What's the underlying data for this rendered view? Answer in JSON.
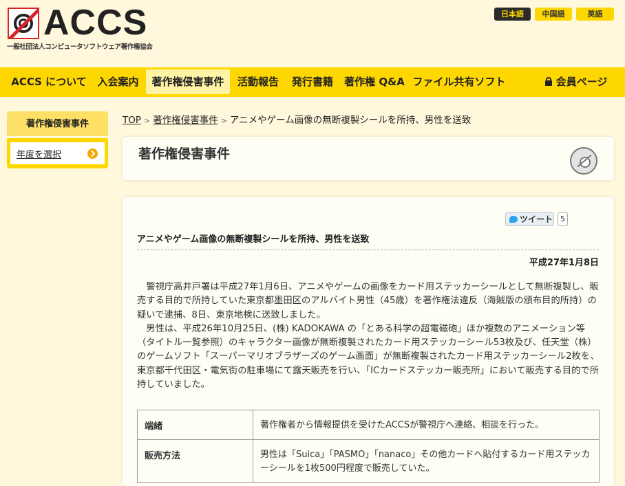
{
  "header": {
    "logo_text": "ACCS",
    "logo_sub": "一般社団法人コンピュータソフトウェア著作権協会",
    "languages": [
      {
        "label": "日本語",
        "active": true
      },
      {
        "label": "中国語",
        "active": false
      },
      {
        "label": "英語",
        "active": false
      }
    ]
  },
  "nav": {
    "items": [
      {
        "label": "ACCS について"
      },
      {
        "label": "入会案内"
      },
      {
        "label": "著作権侵害事件",
        "current": true
      },
      {
        "label": "活動報告"
      },
      {
        "label": "発行書籍"
      },
      {
        "label": "著作権 Q&A"
      },
      {
        "label": "ファイル共有ソフト"
      }
    ],
    "member_label": "会員ページ"
  },
  "sidebar": {
    "title": "著作権侵害事件",
    "select_label": "年度を選択"
  },
  "breadcrumb": {
    "top": "TOP",
    "category": "著作権侵害事件",
    "current": "アニメやゲーム画像の無断複製シールを所持、男性を送致"
  },
  "section": {
    "title": "著作権侵害事件"
  },
  "article": {
    "tweet_label": "ツイート",
    "tweet_count": "5",
    "title": "アニメやゲーム画像の無断複製シールを所持、男性を送致",
    "date": "平成27年1月8日",
    "paragraphs": [
      "警視庁高井戸署は平成27年1月6日、アニメやゲームの画像をカード用ステッカーシールとして無断複製し、販売する目的で所持していた東京都墨田区のアルバイト男性（45歳）を著作権法違反（海賊版の頒布目的所持）の疑いで逮捕、8日、東京地検に送致しました。",
      "男性は、平成26年10月25日、(株) KADOKAWA の「とある科学の超電磁砲」ほか複数のアニメーション等（タイトル一覧参照）のキャラクター画像が無断複製されたカード用ステッカーシール53枚及び、任天堂（株）のゲームソフト「スーパーマリオブラザーズのゲーム画面」が無断複製されたカード用ステッカーシール2枚を、東京都千代田区・電気街の駐車場にて露天販売を行い、「ICカードステッカー販売所」において販売する目的で所持していました。"
    ],
    "table": [
      {
        "label": "端緒",
        "value": "著作権者から情報提供を受けたACCSが警視庁へ連絡、相談を行った。"
      },
      {
        "label": "販売方法",
        "value": "男性は「Suica」「PASMO」「nanaco」その他カードへ貼付するカード用ステッカーシールを1枚500円程度で販売していた。"
      }
    ]
  }
}
